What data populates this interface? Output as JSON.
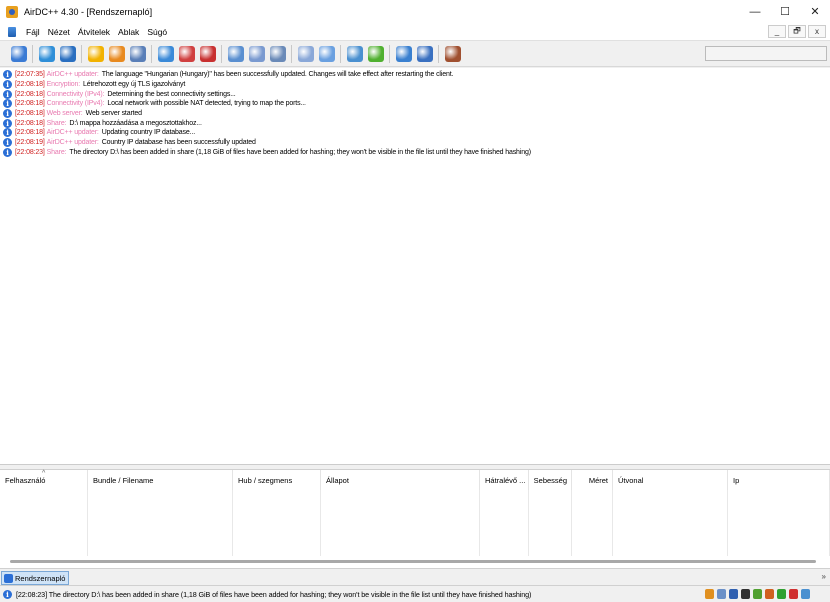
{
  "window": {
    "title": "AirDC++ 4.30 - [Rendszernapló]",
    "minimize": "—",
    "maximize": "☐",
    "close": "✕"
  },
  "menu": {
    "items": [
      "Fájl",
      "Nézet",
      "Átvitelek",
      "Ablak",
      "Súgó"
    ],
    "mdi_minimize": "_",
    "mdi_restore": "🗗",
    "mdi_close": "x"
  },
  "toolbar": {
    "icons": [
      {
        "name": "connect-icon",
        "color": "#3b7bd4"
      },
      {
        "name": "reconnect-icon",
        "color": "#2f8fd8"
      },
      {
        "name": "follow-redirect-icon",
        "color": "#2a6fc0"
      },
      {
        "name": "favorites-icon",
        "color": "#f2b200"
      },
      {
        "name": "favorite-users-icon",
        "color": "#e88a20"
      },
      {
        "name": "users-icon",
        "color": "#5a7fb8"
      },
      {
        "name": "queue-icon",
        "color": "#3b8ad8"
      },
      {
        "name": "finished-downloads-icon",
        "color": "#d04040"
      },
      {
        "name": "finished-uploads-icon",
        "color": "#c83030"
      },
      {
        "name": "search-icon",
        "color": "#5a8fd0"
      },
      {
        "name": "adl-search-icon",
        "color": "#7a9ad0"
      },
      {
        "name": "search-spy-icon",
        "color": "#6a8ab8"
      },
      {
        "name": "notepad-icon",
        "color": "#8aa8d8"
      },
      {
        "name": "system-log-icon",
        "color": "#6aa0e0"
      },
      {
        "name": "open-filelist-icon",
        "color": "#4a90d0"
      },
      {
        "name": "plugins-icon",
        "color": "#50b030"
      },
      {
        "name": "open-folder-icon",
        "color": "#3a80d0"
      },
      {
        "name": "refresh-share-icon",
        "color": "#3a70c0"
      },
      {
        "name": "settings-icon",
        "color": "#a05030"
      }
    ],
    "search_placeholder": ""
  },
  "log": [
    {
      "time": "[22:07:35]",
      "source": "AirDC++ updater:",
      "message": "The language \"Hungarian (Hungary)\" has been successfully updated. Changes will take effect after restarting the client."
    },
    {
      "time": "[22:08:18]",
      "source": "Encryption:",
      "message": "Létrehozott egy új TLS igazolványt"
    },
    {
      "time": "[22:08:18]",
      "source": "Connectivity (IPv4):",
      "message": "Determining the best connectivity settings..."
    },
    {
      "time": "[22:08:18]",
      "source": "Connectivity (IPv4):",
      "message": "Local network with possible NAT detected, trying to map the ports..."
    },
    {
      "time": "[22:08:18]",
      "source": "Web server:",
      "message": "Web server started"
    },
    {
      "time": "[22:08:18]",
      "source": "Share:",
      "message": "D:\\ mappa hozzáadása a megosztottakhoz..."
    },
    {
      "time": "[22:08:18]",
      "source": "AirDC++ updater:",
      "message": "Updating country IP database..."
    },
    {
      "time": "[22:08:19]",
      "source": "AirDC++ updater:",
      "message": "Country IP database has been successfully updated"
    },
    {
      "time": "[22:08:23]",
      "source": "Share:",
      "message": "The directory D:\\ has been added in share (1,18 GiB of files have been added for hashing; they won't be visible in the file list until they have finished hashing)"
    }
  ],
  "queue": {
    "sort_indicator": "^",
    "columns": [
      "Felhasználó",
      "Bundle / Filename",
      "Hub / szegmens",
      "Állapot",
      "Hátralévő ...",
      "Sebesség",
      "Méret",
      "Útvonal",
      "Ip"
    ]
  },
  "tabs": {
    "active": "Rendszernapló",
    "more": "»"
  },
  "status": {
    "text": "[22:08:23] The directory D:\\ has been added in share (1,18 GiB of files have been added for hashing; they won't be visible in the file list until they have finished hashing)",
    "icons": [
      {
        "name": "away-icon",
        "color": "#e09020"
      },
      {
        "name": "shutdown-icon",
        "color": "#6a90c8"
      },
      {
        "name": "limiter-icon",
        "color": "#3060b0"
      },
      {
        "name": "traffic-icon",
        "color": "#303030"
      },
      {
        "name": "upload-slots-icon",
        "color": "#50a030"
      },
      {
        "name": "download-slots-icon",
        "color": "#d06020"
      },
      {
        "name": "download-arrow-icon",
        "color": "#30a030"
      },
      {
        "name": "upload-arrow-icon",
        "color": "#d03030"
      },
      {
        "name": "hubs-icon",
        "color": "#4a90d0"
      }
    ]
  }
}
